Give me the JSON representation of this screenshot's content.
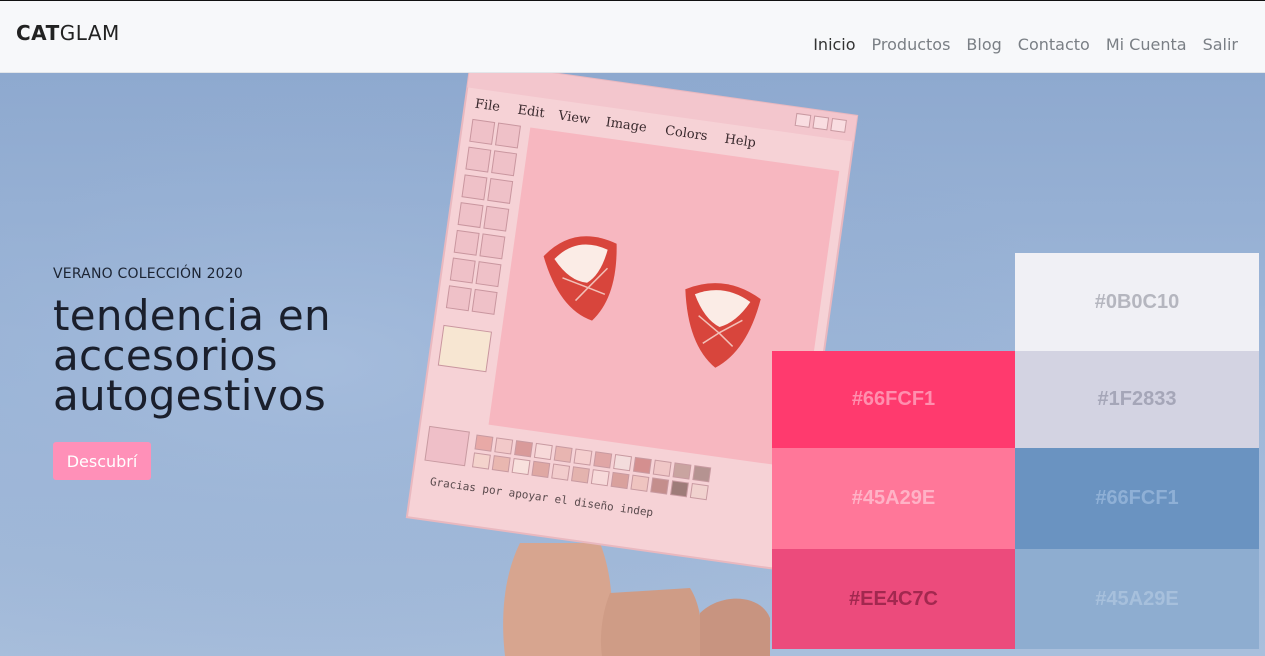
{
  "brand": {
    "part1": "CAT",
    "part2": "GLAM"
  },
  "nav": {
    "items": [
      "Inicio",
      "Productos",
      "Blog",
      "Contacto",
      "Mi Cuenta",
      "Salir"
    ]
  },
  "hero": {
    "eyebrow": "VERANO COLECCIÓN 2020",
    "headline": "tendencia en accesorios autogestivos",
    "cta_label": "Descubrí",
    "photo_menu": [
      "File",
      "Edit",
      "View",
      "Image",
      "Colors",
      "Help"
    ],
    "photo_caption": "Gracias por apoyar el diseño indep"
  },
  "palette": [
    {
      "label": "#0B0C10",
      "bg": "#f0f0f5",
      "fg": "#b5b6bf"
    },
    {
      "label": "#66FCF1",
      "bg": "#ff3a6e",
      "fg": "#ff8fae"
    },
    {
      "label": "#1F2833",
      "bg": "#d3d3e2",
      "fg": "#a5a6b8"
    },
    {
      "label": "#45A29E",
      "bg": "#ff7799",
      "fg": "#ffb2c6"
    },
    {
      "label": "#66FCF1",
      "bg": "#6a93c1",
      "fg": "#8fb0d6"
    },
    {
      "label": "#EE4C7C",
      "bg": "#ec4b7c",
      "fg": "#a2284f"
    },
    {
      "label": "#45A29E",
      "bg": "#8eadd0",
      "fg": "#a7c0dc"
    }
  ]
}
